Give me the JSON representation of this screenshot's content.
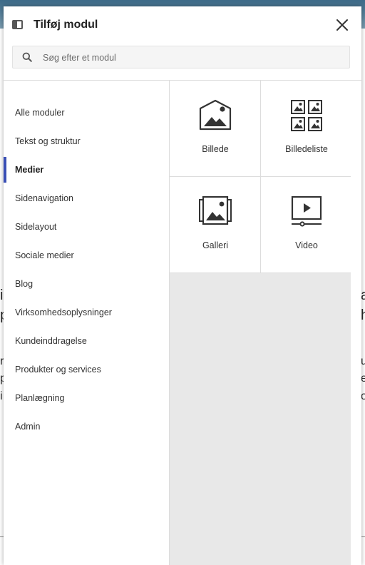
{
  "modal": {
    "title": "Tilføj modul",
    "close_label": "Luk"
  },
  "search": {
    "placeholder": "Søg efter et modul",
    "value": ""
  },
  "sidebar": {
    "active_index": 2,
    "items": [
      {
        "label": "Alle moduler"
      },
      {
        "label": "Tekst og struktur"
      },
      {
        "label": "Medier"
      },
      {
        "label": "Sidenavigation"
      },
      {
        "label": "Sidelayout"
      },
      {
        "label": "Sociale medier"
      },
      {
        "label": "Blog"
      },
      {
        "label": "Virksomhedsoplysninger"
      },
      {
        "label": "Kundeinddragelse"
      },
      {
        "label": "Produkter og services"
      },
      {
        "label": "Planlægning"
      },
      {
        "label": "Admin"
      }
    ]
  },
  "modules": [
    {
      "label": "Billede",
      "icon": "image-icon"
    },
    {
      "label": "Billedeliste",
      "icon": "image-list-icon"
    },
    {
      "label": "Galleri",
      "icon": "gallery-icon"
    },
    {
      "label": "Video",
      "icon": "video-icon"
    }
  ],
  "background": {
    "left_glyphs": [
      "i",
      "p",
      "r",
      "p",
      "i"
    ],
    "right_glyphs": [
      "a",
      "h",
      "u",
      "e",
      "o"
    ]
  },
  "colors": {
    "accent": "#3a4fb5",
    "icon": "#333333",
    "content_bg": "#e8e8e8"
  }
}
